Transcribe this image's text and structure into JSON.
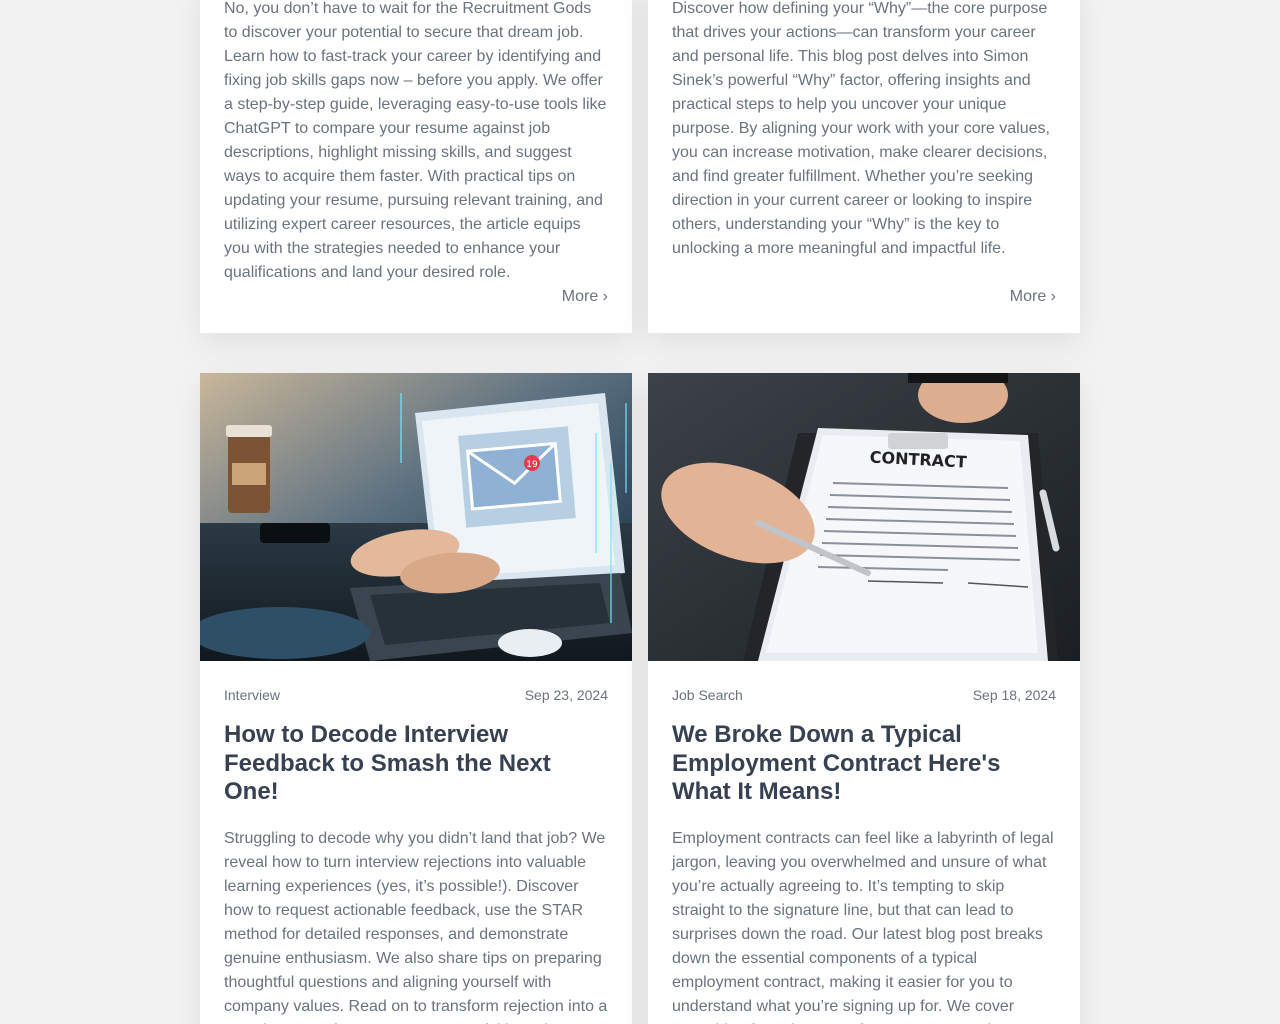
{
  "posts_top": [
    {
      "excerpt": "No, you don’t have to wait for the Recruitment Gods to discover your potential to secure that dream job. Learn how to fast-track your career by identifying and fixing job skills gaps now – before you apply. We offer a step-by-step guide, leveraging easy-to-use tools like ChatGPT to compare your resume against job descriptions, highlight missing skills, and suggest ways to acquire them faster. With practical tips on updating your resume, pursuing relevant training, and utilizing expert career resources, the article equips you with the strategies needed to enhance your qualifications and land your desired role.",
      "more_label": "More ›"
    },
    {
      "excerpt": "Discover how defining your “Why”—the core purpose that drives your actions—can transform your career and personal life. This blog post delves into Simon Sinek’s powerful “Why” factor, offering insights and practical steps to help you uncover your unique purpose. By aligning your work with your core values, you can increase motivation, make clearer decisions, and find greater fulfillment. Whether you’re seeking direction in your current career or looking to inspire others, understanding your “Why” is the key to unlocking a more meaningful and impactful life.",
      "more_label": "More ›"
    }
  ],
  "posts_bottom": [
    {
      "category": "Interview",
      "date": "Sep 23, 2024",
      "title": "How to Decode Interview Feedback to Smash the Next One!",
      "excerpt": "Struggling to decode why you didn’t land that job? We reveal how to turn interview rejections into valuable learning experiences (yes, it’s possible!). Discover how to request actionable feedback, use the STAR method for detailed responses, and demonstrate genuine enthusiasm. We also share tips on preparing thoughtful questions and aligning yourself with company values. Read on to transform rejection into a stepping stone for your next successful interview!",
      "image_badge": "19",
      "image_icon": "laptop-email-icon"
    },
    {
      "category": "Job Search",
      "date": "Sep 18, 2024",
      "title": "We Broke Down a Typical Employment Contract Here's What It Means!",
      "excerpt": "Employment contracts can feel like a labyrinth of legal jargon, leaving you overwhelmed and unsure of what you’re actually agreeing to. It’s tempting to skip straight to the signature line, but that can lead to surprises down the road. Our latest blog post breaks down the essential components of a typical employment contract, making it easier for you to understand what you’re signing up for. We cover everything from the term of your contract and",
      "image_heading": "CONTRACT",
      "image_icon": "contract-signing-icon"
    }
  ],
  "colors": {
    "background": "#f2f2f2",
    "card": "#ffffff",
    "title": "#374151",
    "text": "#6b7280"
  }
}
